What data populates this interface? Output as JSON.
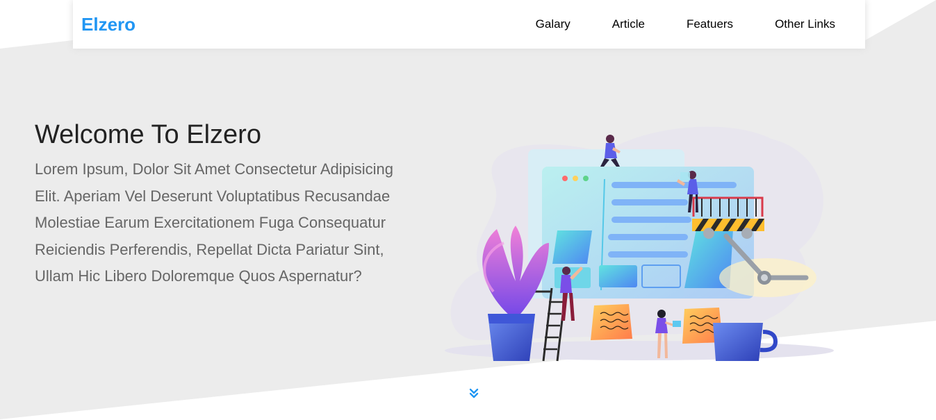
{
  "header": {
    "logo": "Elzero",
    "nav": [
      {
        "label": "Galary"
      },
      {
        "label": "Article"
      },
      {
        "label": "Featuers"
      },
      {
        "label": "Other Links"
      }
    ]
  },
  "intro": {
    "title": "Welcome To Elzero",
    "text": "Lorem Ipsum, Dolor Sit Amet Consectetur Adipisicing Elit. Aperiam Vel Deserunt Voluptatibus Recusandae Molestiae Earum Exercitationem Fuga Consequatur Reiciendis Perferendis, Repellat Dicta Pariatur Sint, Ullam Hic Libero Doloremque Quos Aspernatur?"
  },
  "illustration": {
    "icon": "website-building-illustration"
  },
  "go_down": {
    "icon": "double-chevron-down-icon"
  },
  "colors": {
    "accent": "#2196f3",
    "landing_bg": "#ececec",
    "text_dark": "#222222",
    "text_muted": "#666666"
  }
}
